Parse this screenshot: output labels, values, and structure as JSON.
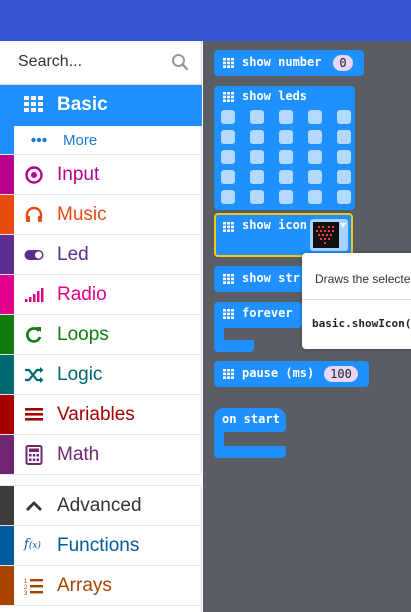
{
  "search": {
    "placeholder": "Search..."
  },
  "categories": {
    "basic": "Basic",
    "more": "More",
    "input": "Input",
    "music": "Music",
    "led": "Led",
    "radio": "Radio",
    "loops": "Loops",
    "logic": "Logic",
    "variables": "Variables",
    "math": "Math",
    "advanced": "Advanced",
    "functions": "Functions",
    "arrays": "Arrays"
  },
  "colors": {
    "basic": "#1e90ff",
    "input": "#b8008f",
    "music": "#e84a10",
    "led": "#5c2d91",
    "radio": "#e3008c",
    "loops": "#107c10",
    "logic": "#006970",
    "variables": "#a80000",
    "math": "#712672",
    "advanced": "#3c3c3c",
    "functions": "#005a9e",
    "arrays": "#a94400"
  },
  "blocks": {
    "show_number": "show number",
    "show_number_value": "0",
    "show_leds": "show leds",
    "show_icon": "show icon",
    "show_string": "show str",
    "forever": "forever",
    "pause": "pause (ms)",
    "pause_value": "100",
    "on_start": "on start"
  },
  "tooltip": {
    "description": "Draws the selecte",
    "code": "basic.showIcon("
  }
}
